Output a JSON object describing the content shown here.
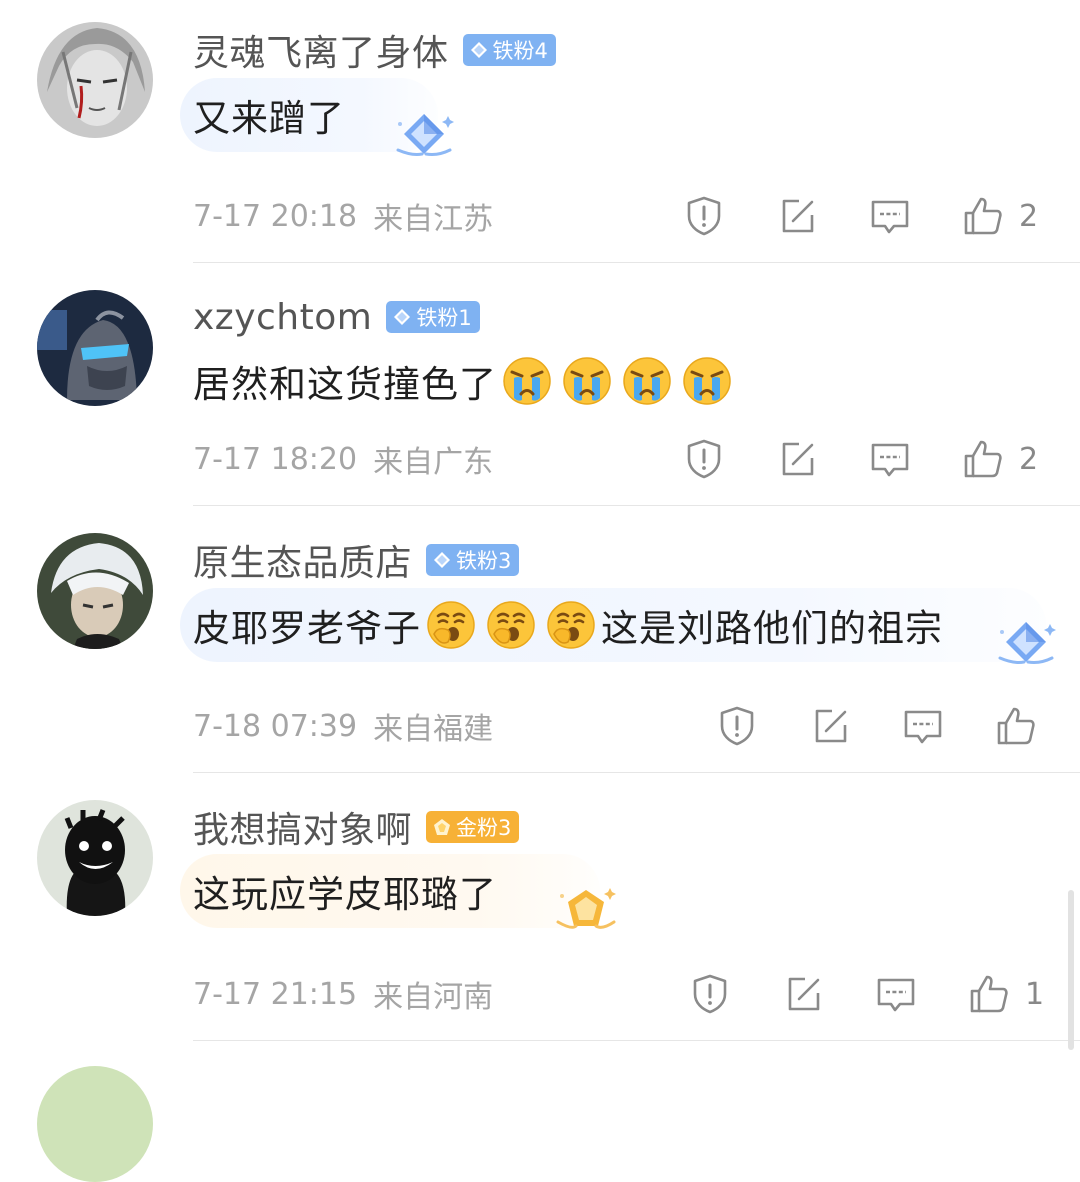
{
  "comments": [
    {
      "username": "灵魂飞离了身体",
      "badge": {
        "label": "铁粉4",
        "tier": "iron",
        "color": "#7fb2f2"
      },
      "text": "又来蹭了",
      "emoji_count": 0,
      "time": "7-17 20:18",
      "location": "来自江苏",
      "likes": "2",
      "avatar_icon": "avatar-silver-hair-icon"
    },
    {
      "username": "xzychtom",
      "badge": {
        "label": "铁粉1",
        "tier": "iron",
        "color": "#7fb2f2"
      },
      "text": "居然和这货撞色了",
      "emoji": "crying-face-icon",
      "emoji_count": 4,
      "time": "7-17 18:20",
      "location": "来自广东",
      "likes": "2",
      "avatar_icon": "avatar-alien-helmet-icon"
    },
    {
      "username": "原生态品质店",
      "badge": {
        "label": "铁粉3",
        "tier": "iron",
        "color": "#7fb2f2"
      },
      "text_before": "皮耶罗老爷子",
      "emoji": "yawning-face-icon",
      "emoji_count": 3,
      "text_after": "这是刘路他们的祖宗",
      "time": "7-18 07:39",
      "location": "来自福建",
      "likes": "",
      "avatar_icon": "avatar-white-hair-icon"
    },
    {
      "username": "我想搞对象啊",
      "badge": {
        "label": "金粉3",
        "tier": "gold",
        "color": "#f7b136"
      },
      "text": "这玩应学皮耶璐了",
      "emoji_count": 0,
      "time": "7-17 21:15",
      "location": "来自河南",
      "likes": "1",
      "avatar_icon": "avatar-dark-smile-icon"
    }
  ],
  "action_icons": [
    "report-icon",
    "share-icon",
    "reply-icon",
    "like-icon"
  ],
  "colors": {
    "text_primary": "#1f1f1f",
    "text_secondary": "#a5a5a5",
    "iron_badge": "#7fb2f2",
    "gold_badge": "#f7b136",
    "divider": "#e6e6e6"
  }
}
